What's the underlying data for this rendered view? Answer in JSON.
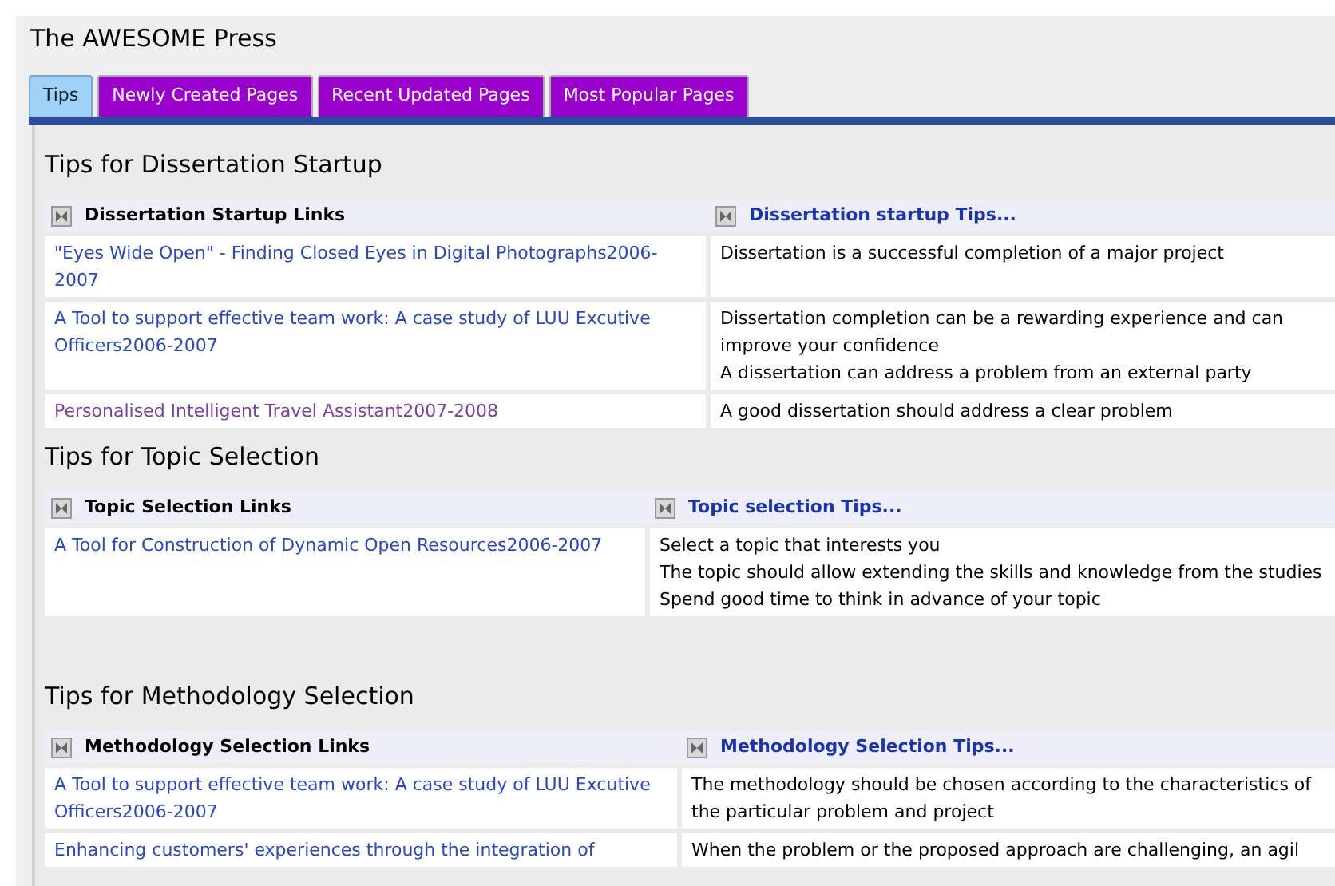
{
  "title": "The AWESOME Press",
  "tabs": [
    {
      "label": "Tips",
      "selected": true
    },
    {
      "label": "Newly Created Pages",
      "selected": false
    },
    {
      "label": "Recent Updated Pages",
      "selected": false
    },
    {
      "label": "Most Popular Pages",
      "selected": false
    }
  ],
  "sections": [
    {
      "heading": "Tips for Dissertation Startup",
      "links_header": "Dissertation Startup Links",
      "tips_header": "Dissertation startup Tips...",
      "rows": [
        {
          "link": "\"Eyes Wide Open\" - Finding Closed Eyes in Digital Photographs2006-2007",
          "visited": false,
          "tips": [
            "Dissertation is a successful completion of a major project"
          ]
        },
        {
          "link": "A Tool to support effective team work: A case study of LUU Excutive Officers2006-2007",
          "visited": false,
          "tips": [
            "Dissertation completion can be a rewarding experience and can improve your confidence",
            "A dissertation can address a problem from an external party"
          ]
        },
        {
          "link": "Personalised Intelligent Travel Assistant2007-2008",
          "visited": true,
          "tips": [
            "A good dissertation should address a clear problem"
          ]
        }
      ]
    },
    {
      "heading": "Tips for Topic Selection",
      "links_header": "Topic Selection Links",
      "tips_header": "Topic selection Tips...",
      "rows": [
        {
          "link": "A Tool for Construction of Dynamic Open Resources2006-2007",
          "visited": false,
          "tips": [
            "Select a topic that interests you",
            "The topic should allow extending the skills and knowledge from the studies",
            "Spend good time to think in advance of your topic"
          ]
        }
      ]
    },
    {
      "heading": "Tips for Methodology Selection",
      "links_header": "Methodology Selection Links",
      "tips_header": "Methodology Selection Tips...",
      "rows": [
        {
          "link": "A Tool to support effective team work: A case study of LUU Excutive Officers2006-2007",
          "visited": false,
          "tips": [
            "The methodology should be chosen according to the characteristics of the particular problem and project"
          ]
        },
        {
          "link": "Enhancing customers' experiences through the integration of",
          "visited": false,
          "tips": [
            "When the problem or the proposed approach are challenging, an agil"
          ]
        }
      ]
    }
  ]
}
